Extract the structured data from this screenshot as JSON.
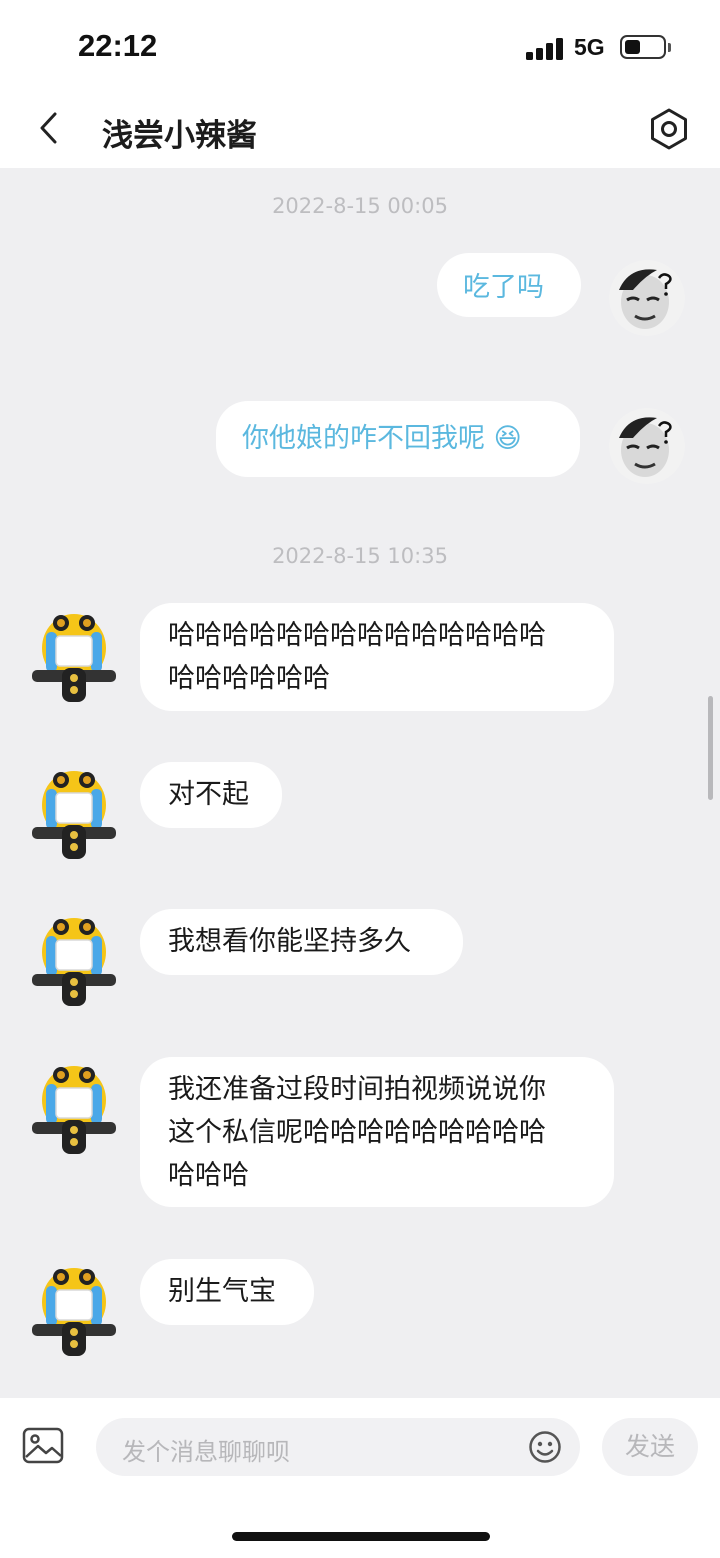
{
  "status_bar": {
    "time": "22:12",
    "network": "5G",
    "battery_level": 0.4
  },
  "header": {
    "title": "浅尝小辣酱",
    "back_icon": "chevron-left-icon",
    "settings_icon": "hexagon-gear-icon"
  },
  "messages": [
    {
      "kind": "timestamp",
      "text": "2022-8-15 00:05"
    },
    {
      "kind": "sent",
      "text": "吃了吗"
    },
    {
      "kind": "sent",
      "text": "你他娘的咋不回我呢",
      "emoji": "😆"
    },
    {
      "kind": "timestamp",
      "text": "2022-8-15 10:35"
    },
    {
      "kind": "received",
      "lines": [
        "哈哈哈哈哈哈哈哈哈哈哈哈哈哈",
        "哈哈哈哈哈哈"
      ]
    },
    {
      "kind": "received",
      "lines": [
        "对不起"
      ]
    },
    {
      "kind": "received",
      "lines": [
        "我想看你能坚持多久"
      ]
    },
    {
      "kind": "received",
      "lines": [
        "我还准备过段时间拍视频说说你",
        "这个私信呢哈哈哈哈哈哈哈哈哈",
        "哈哈哈"
      ]
    },
    {
      "kind": "received",
      "lines": [
        "别生气宝"
      ]
    }
  ],
  "input_bar": {
    "placeholder": "发个消息聊聊呗",
    "send_label": "发送",
    "image_icon": "image-icon",
    "emoji_icon": "smiley-icon"
  },
  "colors": {
    "sent_text": "#5bb8df",
    "background": "#efeff1",
    "timestamp": "#bdbdc0"
  }
}
